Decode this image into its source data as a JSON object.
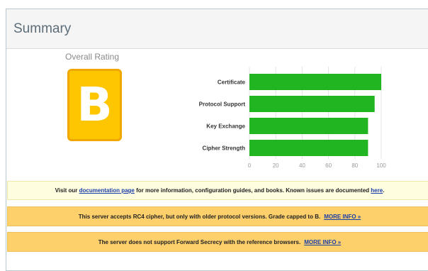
{
  "summary": {
    "title": "Summary",
    "overall_rating_label": "Overall Rating",
    "grade": "B",
    "grade_color": "#fec600",
    "grade_border_color": "#f0a800"
  },
  "chart_data": {
    "type": "bar",
    "orientation": "horizontal",
    "categories": [
      "Certificate",
      "Protocol Support",
      "Key Exchange",
      "Cipher Strength"
    ],
    "values": [
      100,
      95,
      90,
      90
    ],
    "xlim": [
      0,
      100
    ],
    "ticks": [
      "0",
      "20",
      "40",
      "60",
      "80",
      "100"
    ],
    "bar_color": "#22b522",
    "grid": true
  },
  "notices": {
    "info": {
      "prefix": "Visit our ",
      "link1": "documentation page",
      "middle": " for more information, configuration guides, and books. Known issues are documented ",
      "link2": "here",
      "suffix": "."
    },
    "rc4": {
      "text": "This server accepts RC4 cipher, but only with older protocol versions. Grade capped to B.",
      "link": "MORE INFO »"
    },
    "forward_secrecy": {
      "text": "The server does not support Forward Secrecy with the reference browsers.",
      "link": "MORE INFO »"
    }
  }
}
